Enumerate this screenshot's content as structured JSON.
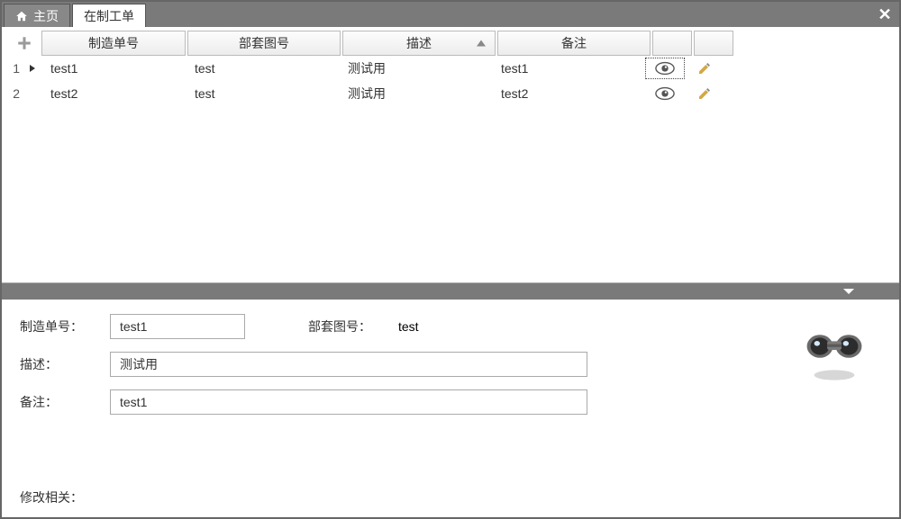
{
  "tabs": {
    "home": "主页",
    "workorder": "在制工单"
  },
  "grid": {
    "headers": {
      "manufacture_no": "制造单号",
      "part_no": "部套图号",
      "description": "描述",
      "remark": "备注"
    },
    "rows": [
      {
        "num": "1",
        "manufacture_no": "test1",
        "part_no": "test",
        "description": "测试用",
        "remark": "test1"
      },
      {
        "num": "2",
        "manufacture_no": "test2",
        "part_no": "test",
        "description": "测试用",
        "remark": "test2"
      }
    ]
  },
  "detail": {
    "labels": {
      "manufacture_no": "制造单号：",
      "part_no": "部套图号：",
      "description": "描述：",
      "remark": "备注："
    },
    "values": {
      "manufacture_no": "test1",
      "part_no": "test",
      "description": "测试用",
      "remark": "test1"
    },
    "modify_related": "修改相关："
  }
}
